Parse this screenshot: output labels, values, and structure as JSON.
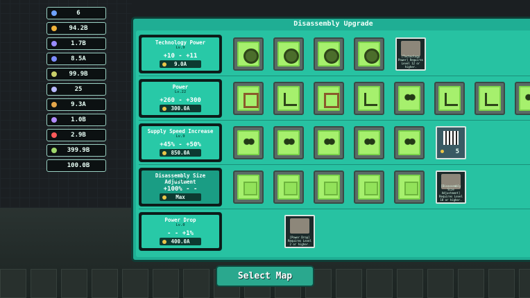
{
  "resources": [
    {
      "value": "6",
      "color": "#6fa3ff",
      "icon": "eye-icon"
    },
    {
      "value": "94.2B",
      "color": "#f0b33a",
      "icon": "coin-icon"
    },
    {
      "value": "1.7B",
      "color": "#9a8cff",
      "icon": "crystal-icon"
    },
    {
      "value": "8.5A",
      "color": "#7d8cff",
      "icon": "gem-icon"
    },
    {
      "value": "99.9B",
      "color": "#c8cf6a",
      "icon": "ore-icon"
    },
    {
      "value": "25",
      "color": "#b8b8ff",
      "icon": "shard-icon"
    },
    {
      "value": "9.3A",
      "color": "#e4a64a",
      "icon": "ingot-icon"
    },
    {
      "value": "1.0B",
      "color": "#b28cff",
      "icon": "orb-icon"
    },
    {
      "value": "2.9B",
      "color": "#ff5a5a",
      "icon": "ruby-icon"
    },
    {
      "value": "399.9B",
      "color": "#9fd86b",
      "icon": "leaf-icon"
    },
    {
      "value": "100.0B",
      "color": "#000000",
      "icon": ""
    }
  ],
  "panel": {
    "title": "Disassembly Upgrade"
  },
  "rows": [
    {
      "name": "Technology Power",
      "level": "Lv.9",
      "range": "+10  -  +11",
      "cost": "9.0A",
      "maxed": false,
      "slots": [
        "gear",
        "gear",
        "gear",
        "gear"
      ],
      "locked": {
        "text": "[Technology Power] Requires Level 12 or higher."
      }
    },
    {
      "name": "Power",
      "level": "Lv.22",
      "range": "+260  -  +300",
      "cost": "300.0A",
      "maxed": false,
      "slots": [
        "frame",
        "arrow",
        "frame",
        "arrow",
        "dots",
        "arrow",
        "arrow",
        "dots"
      ]
    },
    {
      "name": "Supply Speed Increase",
      "level": "Lv.9",
      "range": "+45%  -  +50%",
      "cost": "850.0A",
      "maxed": false,
      "slots": [
        "dots",
        "dots",
        "dots",
        "dots",
        "dots"
      ],
      "counter": {
        "value": "5"
      }
    },
    {
      "name": "Disassembly Size Adjustment",
      "level": "Lv.17",
      "range": "+100%  -   -",
      "cost": "Max",
      "maxed": true,
      "slots": [
        "square",
        "square",
        "square",
        "square",
        "square"
      ],
      "locked": {
        "text": "[Disassembly Size Adjustment] Requires Level 18 or higher."
      }
    },
    {
      "name": "Power Drop",
      "level": "Lv.0",
      "range": " -  -  +1%",
      "cost": "400.0A",
      "maxed": false,
      "slots": [],
      "locked": {
        "text": "[Power Drop] Requires Level 2 or higher."
      }
    }
  ],
  "button": {
    "label": "Select Map"
  }
}
